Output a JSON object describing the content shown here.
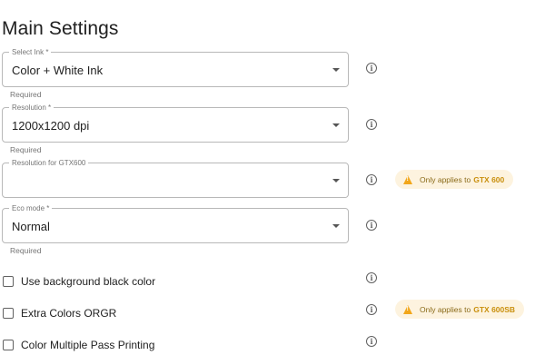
{
  "page": {
    "title": "Main Settings"
  },
  "fields": [
    {
      "label": "Select Ink *",
      "value": "Color + White Ink",
      "helper": "Required"
    },
    {
      "label": "Resolution *",
      "value": "1200x1200 dpi",
      "helper": "Required"
    },
    {
      "label": "Resolution for GTX600",
      "value": "",
      "helper": "",
      "badge": {
        "text": "Only applies to",
        "model": "GTX 600"
      }
    },
    {
      "label": "Eco mode *",
      "value": "Normal",
      "helper": "Required"
    }
  ],
  "checkboxes": [
    {
      "label": "Use background black color",
      "checked": false
    },
    {
      "label": "Extra Colors ORGR",
      "checked": false,
      "badge": {
        "text": "Only applies to",
        "model": "GTX 600SB"
      }
    },
    {
      "label": "Color Multiple Pass Printing",
      "checked": false
    }
  ],
  "icons": {
    "info": "i",
    "warning": "warning-icon",
    "caret": "chevron-down-icon"
  },
  "colors": {
    "badge_bg": "#fdf3df",
    "warning": "#f2a619",
    "border": "#b8b8b8"
  }
}
